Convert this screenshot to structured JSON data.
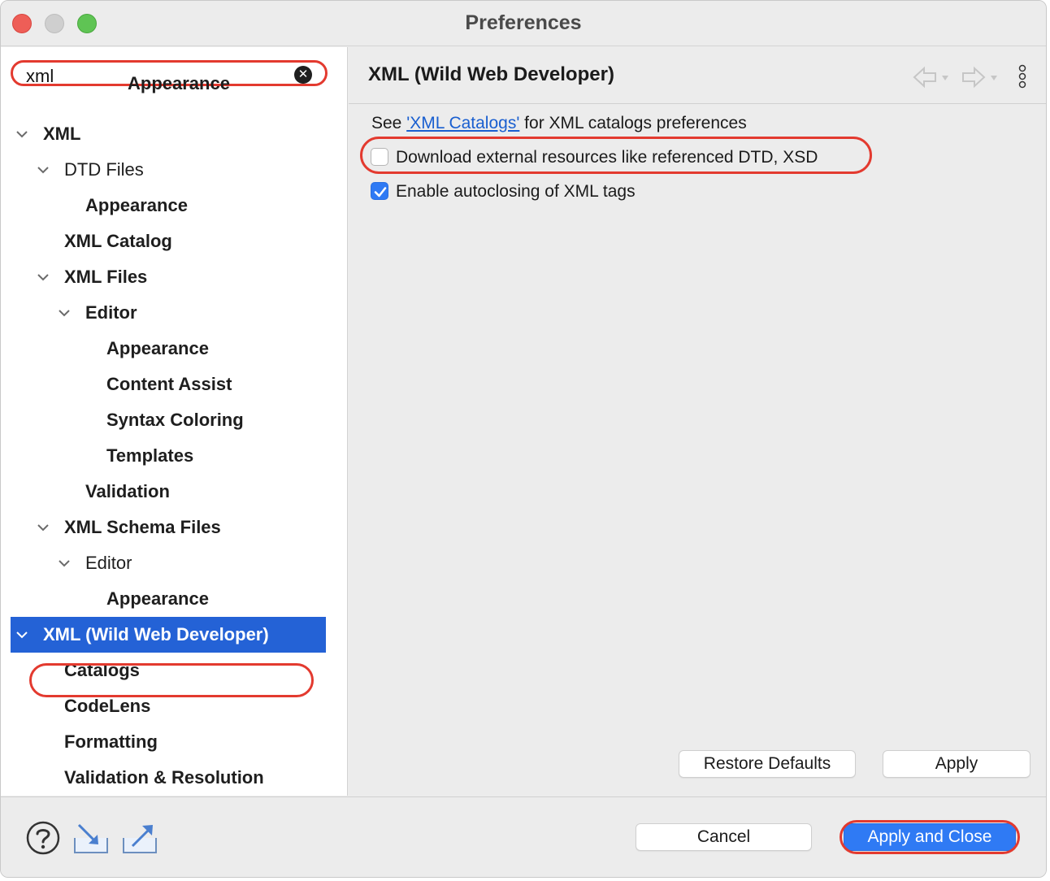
{
  "window": {
    "title": "Preferences"
  },
  "search": {
    "value": "xml",
    "clear_icon": "clear-circle-icon"
  },
  "tree": [
    {
      "label": "Appearance",
      "level": 4,
      "bold": true,
      "expanded": null,
      "partial": true
    },
    {
      "label": "XML",
      "level": 0,
      "bold": true,
      "expanded": true
    },
    {
      "label": "DTD Files",
      "level": 1,
      "bold": false,
      "expanded": true
    },
    {
      "label": "Appearance",
      "level": 2,
      "bold": true,
      "expanded": null
    },
    {
      "label": "XML Catalog",
      "level": 1,
      "bold": true,
      "expanded": null
    },
    {
      "label": "XML Files",
      "level": 1,
      "bold": true,
      "expanded": true
    },
    {
      "label": "Editor",
      "level": 2,
      "bold": true,
      "expanded": true
    },
    {
      "label": "Appearance",
      "level": 3,
      "bold": true,
      "expanded": null
    },
    {
      "label": "Content Assist",
      "level": 3,
      "bold": true,
      "expanded": null
    },
    {
      "label": "Syntax Coloring",
      "level": 3,
      "bold": true,
      "expanded": null
    },
    {
      "label": "Templates",
      "level": 3,
      "bold": true,
      "expanded": null
    },
    {
      "label": "Validation",
      "level": 2,
      "bold": true,
      "expanded": null
    },
    {
      "label": "XML Schema Files",
      "level": 1,
      "bold": true,
      "expanded": true
    },
    {
      "label": "Editor",
      "level": 2,
      "bold": false,
      "expanded": true
    },
    {
      "label": "Appearance",
      "level": 3,
      "bold": true,
      "expanded": null
    },
    {
      "label": "XML (Wild Web Developer)",
      "level": 0,
      "bold": true,
      "expanded": true,
      "selected": true
    },
    {
      "label": "Catalogs",
      "level": 1,
      "bold": true,
      "expanded": null
    },
    {
      "label": "CodeLens",
      "level": 1,
      "bold": true,
      "expanded": null
    },
    {
      "label": "Formatting",
      "level": 1,
      "bold": true,
      "expanded": null
    },
    {
      "label": "Validation & Resolution",
      "level": 1,
      "bold": true,
      "expanded": null
    }
  ],
  "page": {
    "title": "XML (Wild Web Developer)",
    "see_prefix": "See ",
    "see_link": "'XML Catalogs'",
    "see_suffix": " for XML catalogs preferences",
    "option_download": {
      "label": "Download external resources like referenced DTD, XSD",
      "checked": false
    },
    "option_autoclose": {
      "label": "Enable autoclosing of XML tags",
      "checked": true
    },
    "restore_defaults": "Restore Defaults",
    "apply": "Apply"
  },
  "footer": {
    "cancel": "Cancel",
    "apply_and_close": "Apply and Close",
    "icons": [
      "help-icon",
      "import-icon",
      "export-icon"
    ]
  },
  "colors": {
    "selection": "#2462d6",
    "accent": "#2f7af4",
    "highlight": "#e33a2f",
    "link": "#1a5fd0"
  }
}
